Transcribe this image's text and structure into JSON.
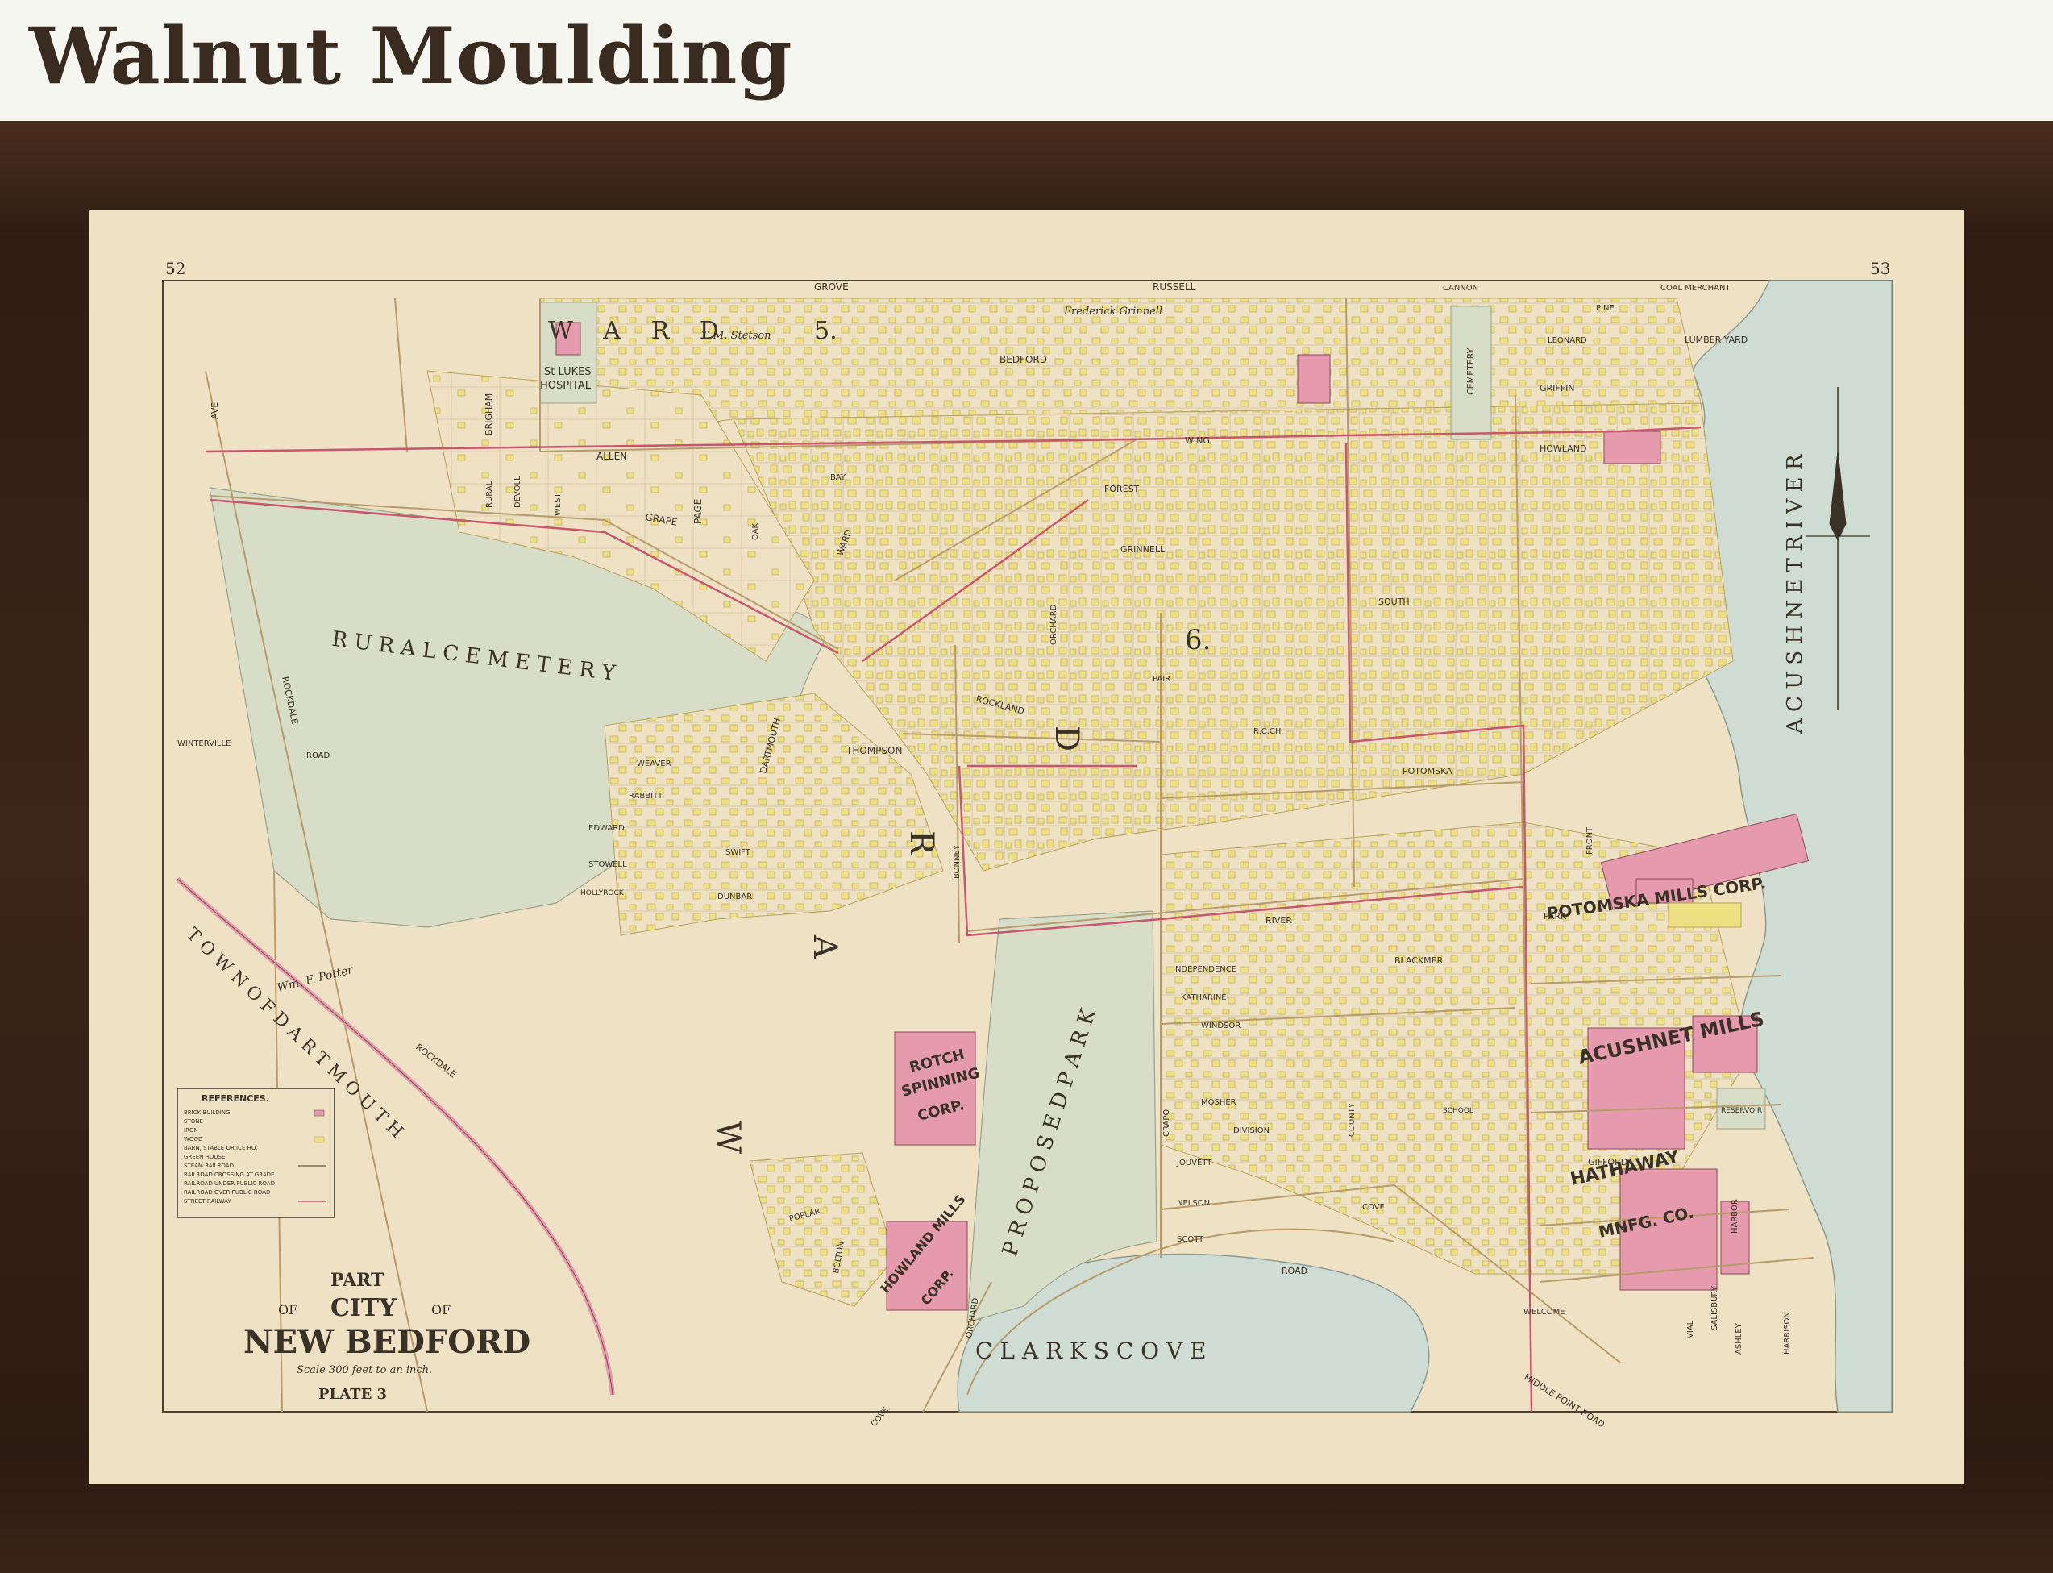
{
  "header": {
    "title": "Walnut Moulding"
  },
  "map": {
    "page_left": "52",
    "page_right": "53",
    "title_block": {
      "part": "PART",
      "of_left": "OF",
      "city": "CITY",
      "of_right": "OF",
      "name": "NEW BEDFORD",
      "scale": "Scale 300 feet to an inch.",
      "plate": "PLATE 3"
    },
    "wards": {
      "ward5_word": "W A R D",
      "ward5_num": "5.",
      "ward6_num": "6.",
      "ward_vertical": [
        "W",
        "A",
        "R",
        "D"
      ]
    },
    "features": {
      "rural_cemetery": "R U R A L   C E M E T E R Y",
      "proposed_park": "P R O P O S E D   P A R K",
      "clarks_cove": "C L A R K S   C O V E",
      "acushnet_river": "A C U S H N E T   R I V E R",
      "town_of_dartmouth": "T O W N   O F   D A R T M O U T H"
    },
    "mills": {
      "potomska": "POTOMSKA MILLS CORP.",
      "acushnet": "ACUSHNET MILLS",
      "hathaway": "HATHAWAY",
      "hathaway_2": "MNFG. CO.",
      "rotch_1": "ROTCH",
      "rotch_2": "SPINNING",
      "rotch_3": "CORP.",
      "howland_1": "HOWLAND MILLS",
      "howland_2": "CORP."
    },
    "places": {
      "st_lukes_1": "St LUKES",
      "st_lukes_2": "HOSPITAL",
      "stetson": "T. M. Stetson",
      "grinnell": "Frederick Grinnell",
      "potter": "Wm. F. Potter",
      "reservoir": "RESERVOIR",
      "lumber_yard": "LUMBER  YARD",
      "coal_merchant": "COAL MERCHANT",
      "cemetery": "CEMETERY",
      "school": "SCHOOL",
      "rc_ch": "R.C.CH."
    },
    "streets": {
      "allen": "ALLEN",
      "grape": "GRAPE",
      "page": "PAGE",
      "brigham": "BRIGHAM",
      "rural": "RURAL",
      "devoll": "DEVOLL",
      "west": "WEST",
      "oak": "OAK",
      "ward": "WARD",
      "bay": "BAY",
      "bedford": "BEDFORD",
      "russell": "RUSSELL",
      "grove": "GROVE",
      "cannon": "CANNON",
      "pine": "PINE",
      "griffin": "GRIFFIN",
      "leonard": "LEONARD",
      "howland": "HOWLAND",
      "wing": "WING",
      "forest": "FOREST",
      "grinnell": "GRINNELL",
      "orchard": "ORCHARD",
      "south": "SOUTH",
      "pair": "PAIR",
      "thompson": "THOMPSON",
      "rockland": "ROCKLAND",
      "dartmouth": "DARTMOUTH",
      "weaver": "WEAVER",
      "rabbitt": "RABBITT",
      "edward": "EDWARD",
      "stowell": "STOWELL",
      "holly": "HOLLYROCK",
      "dunbar": "DUNBAR",
      "swift": "SWIFT",
      "bonney": "BONNEY",
      "potomska": "POTOMSKA",
      "river": "RIVER",
      "blackmer": "BLACKMER",
      "park": "PARK",
      "independence": "INDEPENDENCE",
      "katharine": "KATHARINE",
      "windsor": "WINDSOR",
      "mosher": "MOSHER",
      "division": "DIVISION",
      "jouvett": "JOUVETT",
      "nelson": "NELSON",
      "scott": "SCOTT",
      "cove": "COVE",
      "road": "ROAD",
      "gifford": "GIFFORD",
      "welcome": "WELCOME",
      "middle_point": "MIDDLE POINT ROAD",
      "crapo": "CRAPO",
      "county": "COUNTY",
      "vial": "VIAL",
      "ashley": "ASHLEY",
      "harrison": "HARRISON",
      "salisbury": "SALISBURY",
      "harbor": "HARBOR",
      "rockdale": "ROCKDALE",
      "winterville": "WINTERVILLE",
      "ave": "AVE",
      "st": "ST",
      "road2": "ROAD",
      "poplar": "POPLAR",
      "bolton": "BOLTON",
      "orchard_road": "ORCHARD",
      "cove_road": "COVE",
      "front": "FRONT"
    },
    "legend": {
      "title": "REFERENCES.",
      "items": [
        "BRICK BUILDING",
        "STONE",
        "IRON",
        "WOOD",
        "BARN, STABLE OR ICE HO.",
        "GREEN HOUSE",
        "STEAM RAILROAD",
        "RAILROAD CROSSING AT GRADE",
        "RAILROAD UNDER PUBLIC ROAD",
        "RAILROAD OVER PUBLIC ROAD",
        "STREET RAILWAY"
      ]
    },
    "colors": {
      "paper": "#efe1c4",
      "brick": "#e59aad",
      "wood": "#ede083",
      "water": "#cfdcd4",
      "park": "#d7ddc6",
      "frame": "#3a2418",
      "street_railway": "#c8566d"
    }
  }
}
